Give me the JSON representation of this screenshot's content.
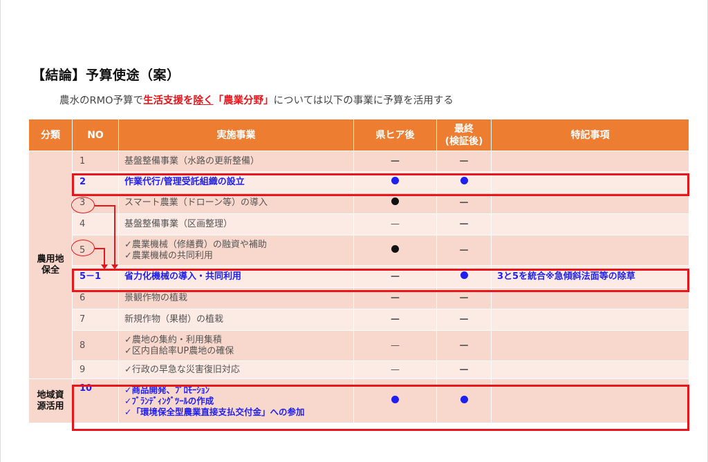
{
  "title": "【結論】予算使途（案）",
  "subtitle": {
    "p1": "農水のRMO予算で",
    "p2": "生活支援を",
    "p3": "除く",
    "p4": "「農業分野」",
    "p5": "については以下の事業に予算を活用する"
  },
  "table": {
    "headers": {
      "category": "分類",
      "no": "NO",
      "project": "実施事業",
      "after_hearing": "県ヒア後",
      "final_line1": "最終",
      "final_line2": "(検証後)",
      "notes": "特記事項"
    },
    "categories": {
      "farmland_line1": "農用地",
      "farmland_line2": "保全",
      "regional_line1": "地域資",
      "regional_line2": "源活用"
    },
    "rows": [
      {
        "no": "1",
        "project_line1": "基盤整備事業（水路の更新整備）",
        "after": "—",
        "final": "—",
        "note": ""
      },
      {
        "no": "2",
        "project_line1": "作業代行/管理受託組織の設立",
        "after": "●",
        "final": "●",
        "note": ""
      },
      {
        "no": "3",
        "project_line1": "スマート農業（ドローン等）の導入",
        "after": "●",
        "final": "—",
        "note": ""
      },
      {
        "no": "4",
        "project_line1": "基盤整備事業（区画整理）",
        "after": "—",
        "final": "—",
        "note": ""
      },
      {
        "no": "5",
        "project_line1": "✓農業機械（修繕費）の融資や補助",
        "project_line2": "✓農業機械の共同利用",
        "after": "●",
        "final": "—",
        "note": ""
      },
      {
        "no": "5－1",
        "project_line1": "省力化機械の導入・共同利用",
        "after": "—",
        "final": "●",
        "note": "3と5を統合※急傾斜法面等の除草"
      },
      {
        "no": "6",
        "project_line1": "景観作物の植栽",
        "after": "—",
        "final": "—",
        "note": ""
      },
      {
        "no": "7",
        "project_line1": "新規作物（果樹）の植栽",
        "after": "—",
        "final": "—",
        "note": ""
      },
      {
        "no": "8",
        "project_line1": "✓農地の集約・利用集積",
        "project_line2": "✓区内自給率UP農地の確保",
        "after": "—",
        "final": "—",
        "note": ""
      },
      {
        "no": "9",
        "project_line1": "✓行政の早急な災害復旧対応",
        "after": "—",
        "final": "—",
        "note": ""
      },
      {
        "no": "10",
        "project_line1": "✓商品開発、ﾌﾟﾛﾓｰｼｮﾝ",
        "project_line2": "✓ﾌﾞﾗﾝﾃﾞｨﾝｸﾞﾂｰﾙの作成",
        "project_line3": "✓「環境保全型農業直接支払交付金」への参加",
        "after": "●",
        "final": "●",
        "note": ""
      }
    ]
  },
  "colors": {
    "header": "#ed7d31",
    "highlight": "#e8151b",
    "emphasis_blue": "#1f1ff0"
  }
}
